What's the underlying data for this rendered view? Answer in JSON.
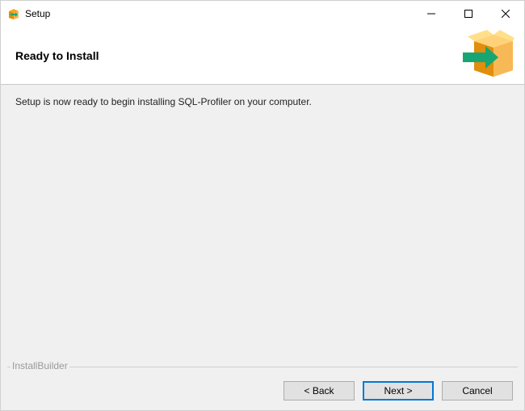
{
  "titlebar": {
    "title": "Setup"
  },
  "header": {
    "heading": "Ready to Install"
  },
  "content": {
    "message": "Setup is now ready to begin installing SQL-Profiler on your computer."
  },
  "footer": {
    "brand": "InstallBuilder",
    "back_label": "< Back",
    "next_label": "Next >",
    "cancel_label": "Cancel"
  }
}
